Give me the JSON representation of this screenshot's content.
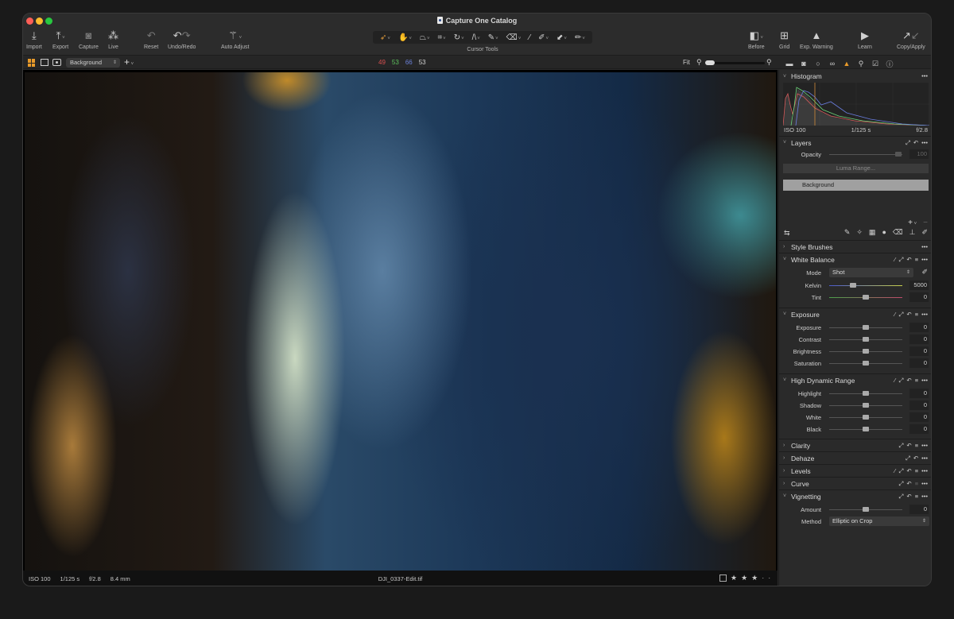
{
  "window": {
    "title": "Capture One Catalog"
  },
  "toolbar": {
    "import": "Import",
    "export": "Export",
    "capture": "Capture",
    "live": "Live",
    "reset": "Reset",
    "undo_redo": "Undo/Redo",
    "auto_adjust": "Auto Adjust",
    "cursor_tools": "Cursor Tools",
    "before": "Before",
    "grid": "Grid",
    "exp_warning": "Exp. Warning",
    "learn": "Learn",
    "copy_apply": "Copy/Apply"
  },
  "cursor_tools": [
    "select",
    "pan",
    "keystone",
    "crop",
    "rotate",
    "straighten",
    "brush",
    "eraser",
    "annotate",
    "picker",
    "gradient",
    "spot"
  ],
  "subbar": {
    "variant": "Background",
    "rgb": {
      "r": "49",
      "g": "53",
      "b": "66",
      "l": "53"
    },
    "fit": "Fit",
    "zoom_level": 0.05
  },
  "tool_tabs": [
    "library",
    "capture",
    "lens",
    "color",
    "exposure",
    "details",
    "adjustments",
    "metadata"
  ],
  "status": {
    "iso": "ISO 100",
    "shutter": "1/125 s",
    "aperture": "f/2.8",
    "focal": "8.4 mm",
    "filename": "DJI_0337-Edit.tif",
    "rating": 3,
    "rating_max": 5
  },
  "panel": {
    "histogram": {
      "title": "Histogram",
      "iso": "ISO 100",
      "shutter": "1/125 s",
      "aperture": "f/2.8"
    },
    "layers": {
      "title": "Layers",
      "opacity_label": "Opacity",
      "opacity_value": "100",
      "luma": "Luma Range...",
      "layer": "Background"
    },
    "style_brushes": {
      "title": "Style Brushes"
    },
    "white_balance": {
      "title": "White Balance",
      "mode_label": "Mode",
      "mode_value": "Shot",
      "kelvin_label": "Kelvin",
      "kelvin_value": "5000",
      "kelvin_pos": 0.33,
      "tint_label": "Tint",
      "tint_value": "0",
      "tint_pos": 0.5
    },
    "exposure": {
      "title": "Exposure",
      "rows": [
        {
          "label": "Exposure",
          "value": "0"
        },
        {
          "label": "Contrast",
          "value": "0"
        },
        {
          "label": "Brightness",
          "value": "0"
        },
        {
          "label": "Saturation",
          "value": "0"
        }
      ]
    },
    "hdr": {
      "title": "High Dynamic Range",
      "rows": [
        {
          "label": "Highlight",
          "value": "0"
        },
        {
          "label": "Shadow",
          "value": "0"
        },
        {
          "label": "White",
          "value": "0"
        },
        {
          "label": "Black",
          "value": "0"
        }
      ]
    },
    "clarity": {
      "title": "Clarity"
    },
    "dehaze": {
      "title": "Dehaze"
    },
    "levels": {
      "title": "Levels"
    },
    "curve": {
      "title": "Curve"
    },
    "vignetting": {
      "title": "Vignetting",
      "amount_label": "Amount",
      "amount_value": "0",
      "method_label": "Method",
      "method_value": "Elliptic on Crop"
    }
  },
  "colors": {
    "accent": "#e89a2a"
  }
}
